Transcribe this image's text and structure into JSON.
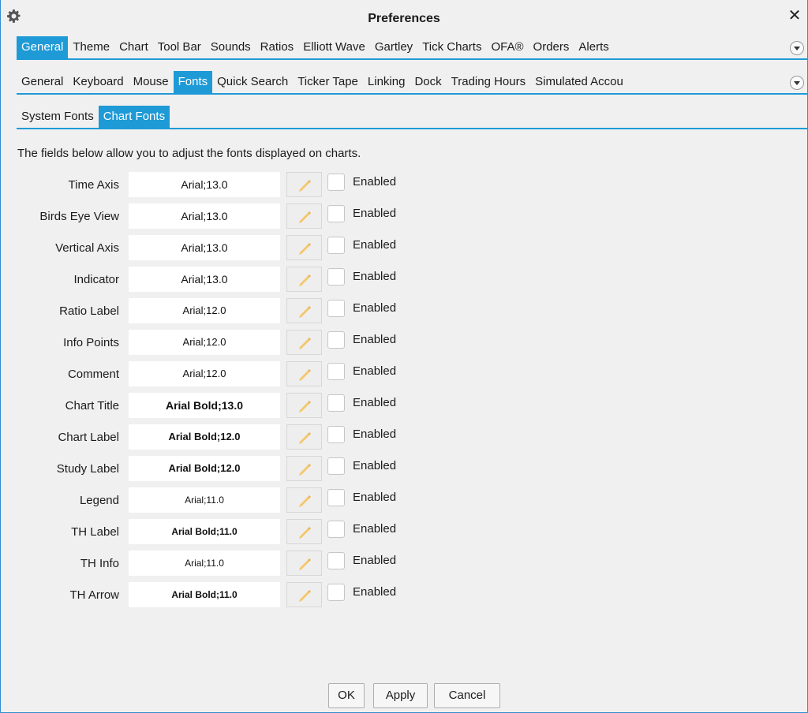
{
  "window": {
    "title": "Preferences",
    "close_glyph": "✕"
  },
  "tabs_level1": [
    {
      "label": "General",
      "active": true
    },
    {
      "label": "Theme"
    },
    {
      "label": "Chart"
    },
    {
      "label": "Tool Bar"
    },
    {
      "label": "Sounds"
    },
    {
      "label": "Ratios"
    },
    {
      "label": "Elliott Wave"
    },
    {
      "label": "Gartley"
    },
    {
      "label": "Tick Charts"
    },
    {
      "label": "OFA®"
    },
    {
      "label": "Orders"
    },
    {
      "label": "Alerts"
    }
  ],
  "tabs_level2": [
    {
      "label": "General"
    },
    {
      "label": "Keyboard"
    },
    {
      "label": "Mouse"
    },
    {
      "label": "Fonts",
      "active": true
    },
    {
      "label": "Quick Search"
    },
    {
      "label": "Ticker Tape"
    },
    {
      "label": "Linking"
    },
    {
      "label": "Dock"
    },
    {
      "label": "Trading Hours"
    },
    {
      "label": "Simulated Accou"
    }
  ],
  "tabs_level3": [
    {
      "label": "System Fonts"
    },
    {
      "label": "Chart Fonts",
      "active": true
    }
  ],
  "description": "The fields below allow you to adjust the fonts displayed on charts.",
  "enabled_label": "Enabled",
  "font_rows": [
    {
      "label": "Time Axis",
      "font": "Arial;13.0",
      "bold": false,
      "size": 13
    },
    {
      "label": "Birds Eye View",
      "font": "Arial;13.0",
      "bold": false,
      "size": 13
    },
    {
      "label": "Vertical Axis",
      "font": "Arial;13.0",
      "bold": false,
      "size": 13
    },
    {
      "label": "Indicator",
      "font": "Arial;13.0",
      "bold": false,
      "size": 13
    },
    {
      "label": "Ratio Label",
      "font": "Arial;12.0",
      "bold": false,
      "size": 12
    },
    {
      "label": "Info Points",
      "font": "Arial;12.0",
      "bold": false,
      "size": 12
    },
    {
      "label": "Comment",
      "font": "Arial;12.0",
      "bold": false,
      "size": 12
    },
    {
      "label": "Chart Title",
      "font": "Arial Bold;13.0",
      "bold": true,
      "size": 13
    },
    {
      "label": "Chart Label",
      "font": "Arial Bold;12.0",
      "bold": true,
      "size": 12
    },
    {
      "label": "Study Label",
      "font": "Arial Bold;12.0",
      "bold": true,
      "size": 12
    },
    {
      "label": "Legend",
      "font": "Arial;11.0",
      "bold": false,
      "size": 11
    },
    {
      "label": "TH Label",
      "font": "Arial Bold;11.0",
      "bold": true,
      "size": 11
    },
    {
      "label": "TH Info",
      "font": "Arial;11.0",
      "bold": false,
      "size": 11
    },
    {
      "label": "TH Arrow",
      "font": "Arial Bold;11.0",
      "bold": true,
      "size": 11
    }
  ],
  "buttons": {
    "ok": "OK",
    "apply": "Apply",
    "cancel": "Cancel"
  },
  "colors": {
    "accent": "#1e9ad6",
    "pencil": "#f5c76a"
  }
}
